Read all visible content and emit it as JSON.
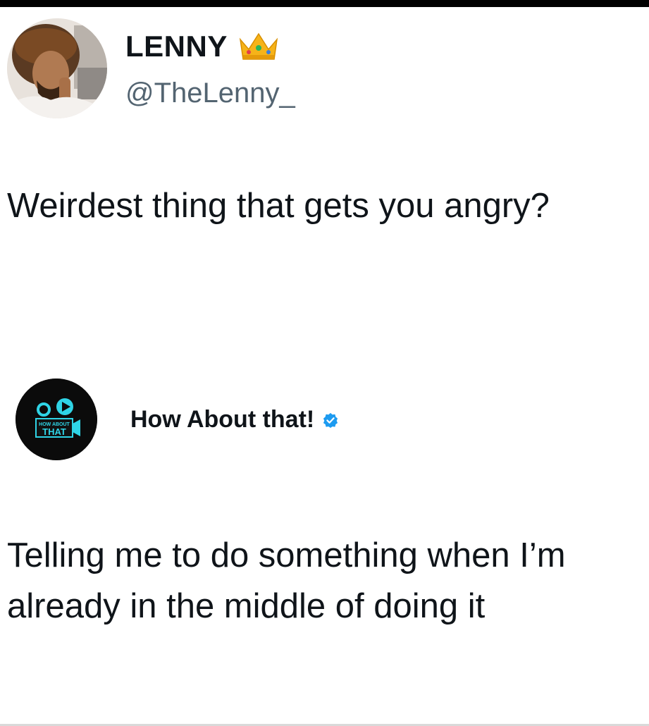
{
  "tweet1": {
    "author_name": "LENNY",
    "author_handle": "@TheLenny_",
    "badge_icon": "crown-icon",
    "text": "Weirdest thing that gets you angry?"
  },
  "tweet2": {
    "author_name": "How About that!",
    "avatar_logo_text": "HOW ABOUT THAT",
    "badge_icon": "verified-check-icon",
    "text": "Telling me to do something when I’m already in the middle of doing it"
  },
  "colors": {
    "text_primary": "#0f1419",
    "text_secondary": "#536471",
    "verified_blue": "#1d9bf0",
    "logo_cyan": "#2fd4e6"
  }
}
